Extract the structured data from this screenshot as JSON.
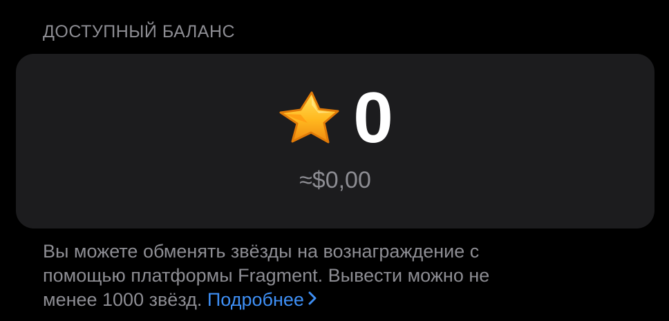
{
  "balance_section": {
    "header": "ДОСТУПНЫЙ БАЛАНС",
    "amount": "0",
    "fiat_value": "≈$0,00",
    "star_icon": "gold-star-icon"
  },
  "footer": {
    "text_line1": "Вы можете обменять звёзды на вознаграждение с",
    "text_line2": "помощью платформы Fragment. Вывести можно не",
    "text_line3": "менее 1000 звёзд.",
    "link_label": "Подробнее",
    "link_icon": "chevron-right-icon"
  },
  "colors": {
    "background": "#000000",
    "card": "#1c1c1e",
    "secondary_text": "#8d8d93",
    "link": "#3e8ff5",
    "star": "#f8b51c"
  }
}
